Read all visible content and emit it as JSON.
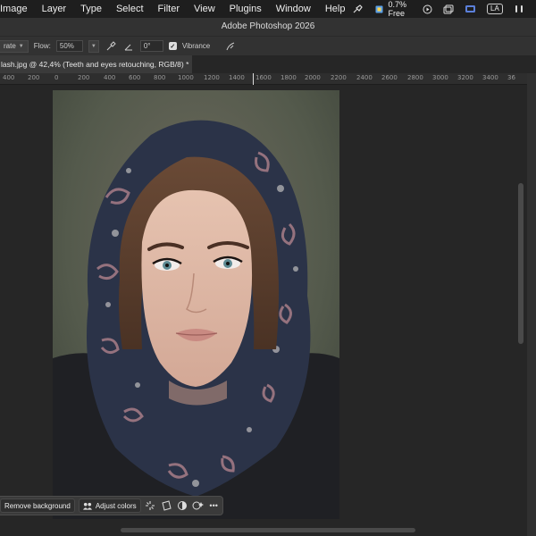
{
  "menubar": {
    "items": [
      "Image",
      "Layer",
      "Type",
      "Select",
      "Filter",
      "View",
      "Plugins",
      "Window",
      "Help"
    ],
    "memory_label": "0.7% Free",
    "input_badge": "LA"
  },
  "app": {
    "title": "Adobe Photoshop 2026"
  },
  "options": {
    "mode_value": "rate",
    "flow_label": "Flow:",
    "flow_value": "50%",
    "angle_value": "0°",
    "vibrance_label": "Vibrance",
    "vibrance_checked": true
  },
  "document": {
    "tab_title": "lash.jpg @ 42,4% (Teeth and eyes retouching, RGB/8) *"
  },
  "ruler": {
    "labels": [
      "400",
      "200",
      "0",
      "200",
      "400",
      "600",
      "800",
      "1000",
      "1200",
      "1400",
      "1600",
      "1800",
      "2000",
      "2200",
      "2400",
      "2600",
      "2800",
      "3000",
      "3200",
      "3400",
      "36"
    ]
  },
  "taskbar": {
    "remove_bg_label": "Remove background",
    "adjust_colors_label": "Adjust colors",
    "more_label": "•••"
  },
  "colors": {
    "menubar_bg": "#1e1e1e",
    "panel_bg": "#323232",
    "canvas_bg": "#262626"
  }
}
